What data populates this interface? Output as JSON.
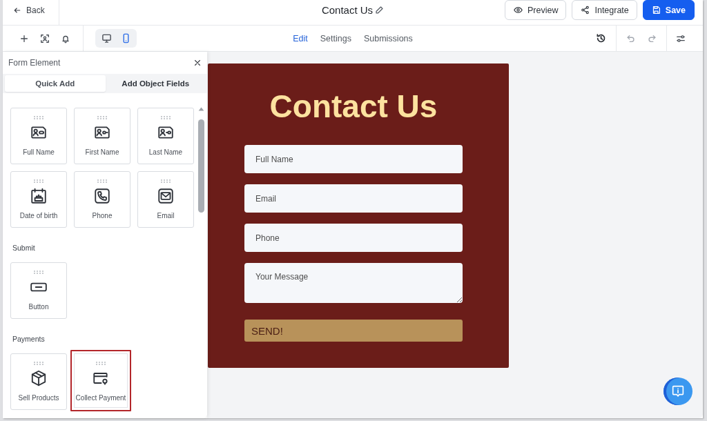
{
  "header": {
    "back": "Back",
    "title": "Contact Us",
    "actions": [
      {
        "label": "Preview",
        "kind": "preview"
      },
      {
        "label": "Integrate",
        "kind": "integrate"
      },
      {
        "label": "Save",
        "kind": "save"
      }
    ]
  },
  "toolbar": {
    "devices": [
      {
        "kind": "desktop",
        "selected": false
      },
      {
        "kind": "mobile",
        "selected": true
      }
    ],
    "tabs": [
      {
        "label": "Edit",
        "selected": true
      },
      {
        "label": "Settings",
        "selected": false
      },
      {
        "label": "Submissions",
        "selected": false
      }
    ],
    "undo": {
      "disabled": true
    },
    "redo": {
      "disabled": true
    }
  },
  "panel": {
    "title": "Form Element",
    "tabs": [
      {
        "label": "Quick Add",
        "selected": true
      },
      {
        "label": "Add Object Fields",
        "selected": false
      }
    ],
    "sections": [
      {
        "items": [
          {
            "label": "Full Name",
            "kind": "fullname",
            "highlighted": false
          },
          {
            "label": "First Name",
            "kind": "firstname",
            "highlighted": false
          },
          {
            "label": "Last Name",
            "kind": "lastname",
            "highlighted": false
          },
          {
            "label": "Date of birth",
            "kind": "birthday",
            "highlighted": false
          },
          {
            "label": "Phone",
            "kind": "phone",
            "highlighted": false
          },
          {
            "label": "Email",
            "kind": "email",
            "highlighted": false
          }
        ]
      },
      {
        "heading": "Submit",
        "items": [
          {
            "label": "Button",
            "kind": "button",
            "highlighted": false
          }
        ]
      },
      {
        "heading": "Payments",
        "items": [
          {
            "label": "Sell Products",
            "kind": "products",
            "highlighted": false
          },
          {
            "label": "Collect Payment",
            "kind": "payment",
            "highlighted": true
          }
        ]
      }
    ]
  },
  "form": {
    "heading": "Contact Us",
    "fields": [
      {
        "placeholder": "Full Name",
        "kind": "input"
      },
      {
        "placeholder": "Email",
        "kind": "input"
      },
      {
        "placeholder": "Phone",
        "kind": "input"
      },
      {
        "placeholder": "Your Message",
        "kind": "textarea"
      }
    ],
    "submit": "SEND!"
  }
}
